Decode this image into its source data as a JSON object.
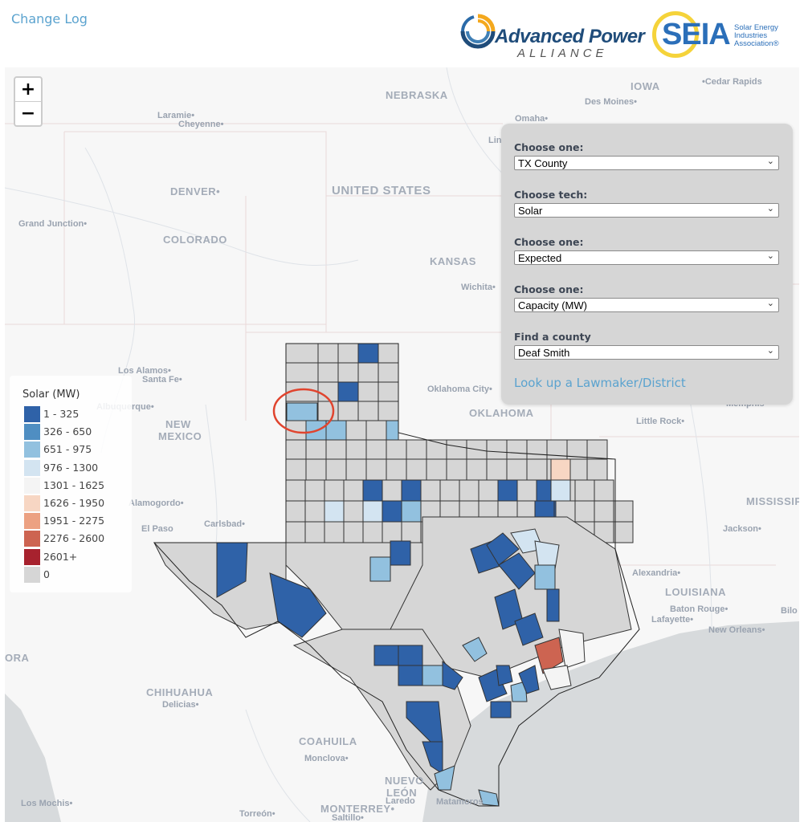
{
  "header": {
    "change_log": "Change Log",
    "logo_apa": {
      "line1": "Advanced Power",
      "line2": "ALLIANCE"
    },
    "logo_seia": {
      "mark": "SEIA",
      "subtitle": "Solar Energy\nIndustries\nAssociation®"
    }
  },
  "map": {
    "zoom_in": "+",
    "zoom_out": "−",
    "labels": {
      "nebraska": "NEBRASKA",
      "iowa": "IOWA",
      "cedar_rapids": "•Cedar Rapids",
      "des_moines": "Des Moines•",
      "omaha": "Omaha•",
      "laramie": "Laramie•",
      "cheyenne": "Cheyenne•",
      "denver": "DENVER•",
      "united_states": "UNITED STATES",
      "lincoln": "Lin",
      "grand_junction": "Grand Junction•",
      "colorado": "COLORADO",
      "kansas": "KANSAS",
      "wichita": "Wichita•",
      "los_alamos": "Los Alamos•",
      "santa_fe": "Santa Fe•",
      "albuquerque": "Albuquerque•",
      "new_mexico_1": "NEW",
      "new_mexico_2": "MEXICO",
      "oklahoma_city": "Oklahoma City•",
      "oklahoma": "OKLAHOMA",
      "little_rock": "Little Rock•",
      "memphis": "Memphis•",
      "mississippi": "MISSISSIPPI",
      "jackson": "Jackson•",
      "alamogordo": "Alamogordo•",
      "carlsbad": "Carlsbad•",
      "el_paso": "El Paso",
      "louisiana": "LOUISIANA",
      "alexandria": "Alexandria•",
      "baton_rouge": "Baton Rouge•",
      "lafayette": "Lafayette•",
      "new_orleans": "New Orleans•",
      "biloxi": "Bilo",
      "sonora": "ORA",
      "chihuahua": "CHIHUAHUA",
      "delicias": "Delicias•",
      "coahuila": "COAHUILA",
      "monclova": "Monclova•",
      "laredo": "Laredo",
      "nuevo_leon_1": "NUEVO",
      "nuevo_leon_2": "LEÓN",
      "monterrey": "MONTERREY•",
      "saltillo": "Saltillo•",
      "torreon": "Torreón•",
      "los_mochis": "Los Mochis•",
      "matamoros": "Matamoros"
    },
    "highlighted_county": "Deaf Smith"
  },
  "legend": {
    "title": "Solar (MW)",
    "items": [
      {
        "label": "1 - 325",
        "color": "#2f62a8"
      },
      {
        "label": "326 - 650",
        "color": "#4f8ec2"
      },
      {
        "label": "651 - 975",
        "color": "#92c1df"
      },
      {
        "label": "976 - 1300",
        "color": "#d3e4f1"
      },
      {
        "label": "1301 - 1625",
        "color": "#f4f4f4"
      },
      {
        "label": "1626 - 1950",
        "color": "#f7d6c3"
      },
      {
        "label": "1951 - 2275",
        "color": "#eca182"
      },
      {
        "label": "2276 - 2600",
        "color": "#cd6451"
      },
      {
        "label": "2601+",
        "color": "#a7222e"
      },
      {
        "label": "0",
        "color": "#d6d6d6"
      }
    ]
  },
  "panel": {
    "selects": [
      {
        "label": "Choose one:",
        "value": "TX County"
      },
      {
        "label": "Choose tech:",
        "value": "Solar"
      },
      {
        "label": "Choose one:",
        "value": "Expected"
      },
      {
        "label": "Choose one:",
        "value": "Capacity (MW)"
      },
      {
        "label": "Find a county",
        "value": "Deaf Smith"
      }
    ],
    "link": "Look up a Lawmaker/District"
  }
}
